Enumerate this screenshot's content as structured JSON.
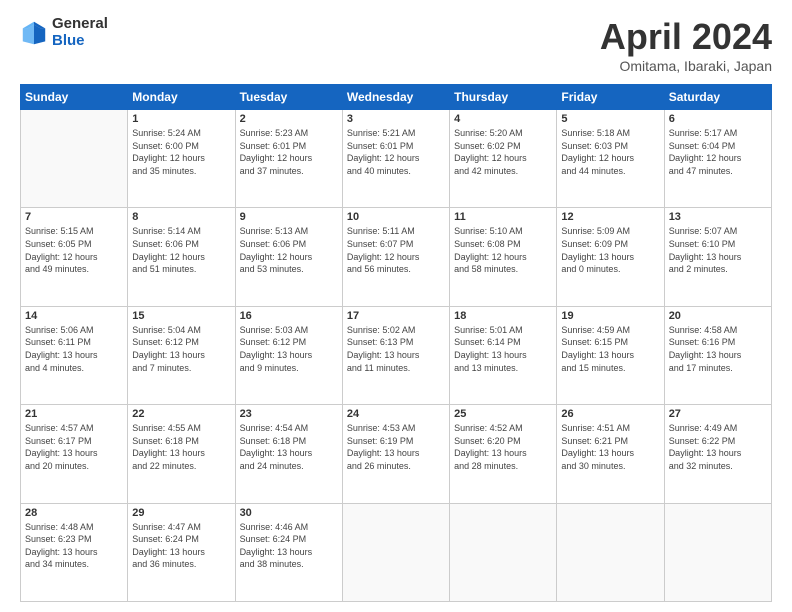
{
  "logo": {
    "general": "General",
    "blue": "Blue"
  },
  "header": {
    "title": "April 2024",
    "subtitle": "Omitama, Ibaraki, Japan"
  },
  "weekdays": [
    "Sunday",
    "Monday",
    "Tuesday",
    "Wednesday",
    "Thursday",
    "Friday",
    "Saturday"
  ],
  "weeks": [
    [
      {
        "day": "",
        "info": ""
      },
      {
        "day": "1",
        "info": "Sunrise: 5:24 AM\nSunset: 6:00 PM\nDaylight: 12 hours\nand 35 minutes."
      },
      {
        "day": "2",
        "info": "Sunrise: 5:23 AM\nSunset: 6:01 PM\nDaylight: 12 hours\nand 37 minutes."
      },
      {
        "day": "3",
        "info": "Sunrise: 5:21 AM\nSunset: 6:01 PM\nDaylight: 12 hours\nand 40 minutes."
      },
      {
        "day": "4",
        "info": "Sunrise: 5:20 AM\nSunset: 6:02 PM\nDaylight: 12 hours\nand 42 minutes."
      },
      {
        "day": "5",
        "info": "Sunrise: 5:18 AM\nSunset: 6:03 PM\nDaylight: 12 hours\nand 44 minutes."
      },
      {
        "day": "6",
        "info": "Sunrise: 5:17 AM\nSunset: 6:04 PM\nDaylight: 12 hours\nand 47 minutes."
      }
    ],
    [
      {
        "day": "7",
        "info": "Sunrise: 5:15 AM\nSunset: 6:05 PM\nDaylight: 12 hours\nand 49 minutes."
      },
      {
        "day": "8",
        "info": "Sunrise: 5:14 AM\nSunset: 6:06 PM\nDaylight: 12 hours\nand 51 minutes."
      },
      {
        "day": "9",
        "info": "Sunrise: 5:13 AM\nSunset: 6:06 PM\nDaylight: 12 hours\nand 53 minutes."
      },
      {
        "day": "10",
        "info": "Sunrise: 5:11 AM\nSunset: 6:07 PM\nDaylight: 12 hours\nand 56 minutes."
      },
      {
        "day": "11",
        "info": "Sunrise: 5:10 AM\nSunset: 6:08 PM\nDaylight: 12 hours\nand 58 minutes."
      },
      {
        "day": "12",
        "info": "Sunrise: 5:09 AM\nSunset: 6:09 PM\nDaylight: 13 hours\nand 0 minutes."
      },
      {
        "day": "13",
        "info": "Sunrise: 5:07 AM\nSunset: 6:10 PM\nDaylight: 13 hours\nand 2 minutes."
      }
    ],
    [
      {
        "day": "14",
        "info": "Sunrise: 5:06 AM\nSunset: 6:11 PM\nDaylight: 13 hours\nand 4 minutes."
      },
      {
        "day": "15",
        "info": "Sunrise: 5:04 AM\nSunset: 6:12 PM\nDaylight: 13 hours\nand 7 minutes."
      },
      {
        "day": "16",
        "info": "Sunrise: 5:03 AM\nSunset: 6:12 PM\nDaylight: 13 hours\nand 9 minutes."
      },
      {
        "day": "17",
        "info": "Sunrise: 5:02 AM\nSunset: 6:13 PM\nDaylight: 13 hours\nand 11 minutes."
      },
      {
        "day": "18",
        "info": "Sunrise: 5:01 AM\nSunset: 6:14 PM\nDaylight: 13 hours\nand 13 minutes."
      },
      {
        "day": "19",
        "info": "Sunrise: 4:59 AM\nSunset: 6:15 PM\nDaylight: 13 hours\nand 15 minutes."
      },
      {
        "day": "20",
        "info": "Sunrise: 4:58 AM\nSunset: 6:16 PM\nDaylight: 13 hours\nand 17 minutes."
      }
    ],
    [
      {
        "day": "21",
        "info": "Sunrise: 4:57 AM\nSunset: 6:17 PM\nDaylight: 13 hours\nand 20 minutes."
      },
      {
        "day": "22",
        "info": "Sunrise: 4:55 AM\nSunset: 6:18 PM\nDaylight: 13 hours\nand 22 minutes."
      },
      {
        "day": "23",
        "info": "Sunrise: 4:54 AM\nSunset: 6:18 PM\nDaylight: 13 hours\nand 24 minutes."
      },
      {
        "day": "24",
        "info": "Sunrise: 4:53 AM\nSunset: 6:19 PM\nDaylight: 13 hours\nand 26 minutes."
      },
      {
        "day": "25",
        "info": "Sunrise: 4:52 AM\nSunset: 6:20 PM\nDaylight: 13 hours\nand 28 minutes."
      },
      {
        "day": "26",
        "info": "Sunrise: 4:51 AM\nSunset: 6:21 PM\nDaylight: 13 hours\nand 30 minutes."
      },
      {
        "day": "27",
        "info": "Sunrise: 4:49 AM\nSunset: 6:22 PM\nDaylight: 13 hours\nand 32 minutes."
      }
    ],
    [
      {
        "day": "28",
        "info": "Sunrise: 4:48 AM\nSunset: 6:23 PM\nDaylight: 13 hours\nand 34 minutes."
      },
      {
        "day": "29",
        "info": "Sunrise: 4:47 AM\nSunset: 6:24 PM\nDaylight: 13 hours\nand 36 minutes."
      },
      {
        "day": "30",
        "info": "Sunrise: 4:46 AM\nSunset: 6:24 PM\nDaylight: 13 hours\nand 38 minutes."
      },
      {
        "day": "",
        "info": ""
      },
      {
        "day": "",
        "info": ""
      },
      {
        "day": "",
        "info": ""
      },
      {
        "day": "",
        "info": ""
      }
    ]
  ]
}
